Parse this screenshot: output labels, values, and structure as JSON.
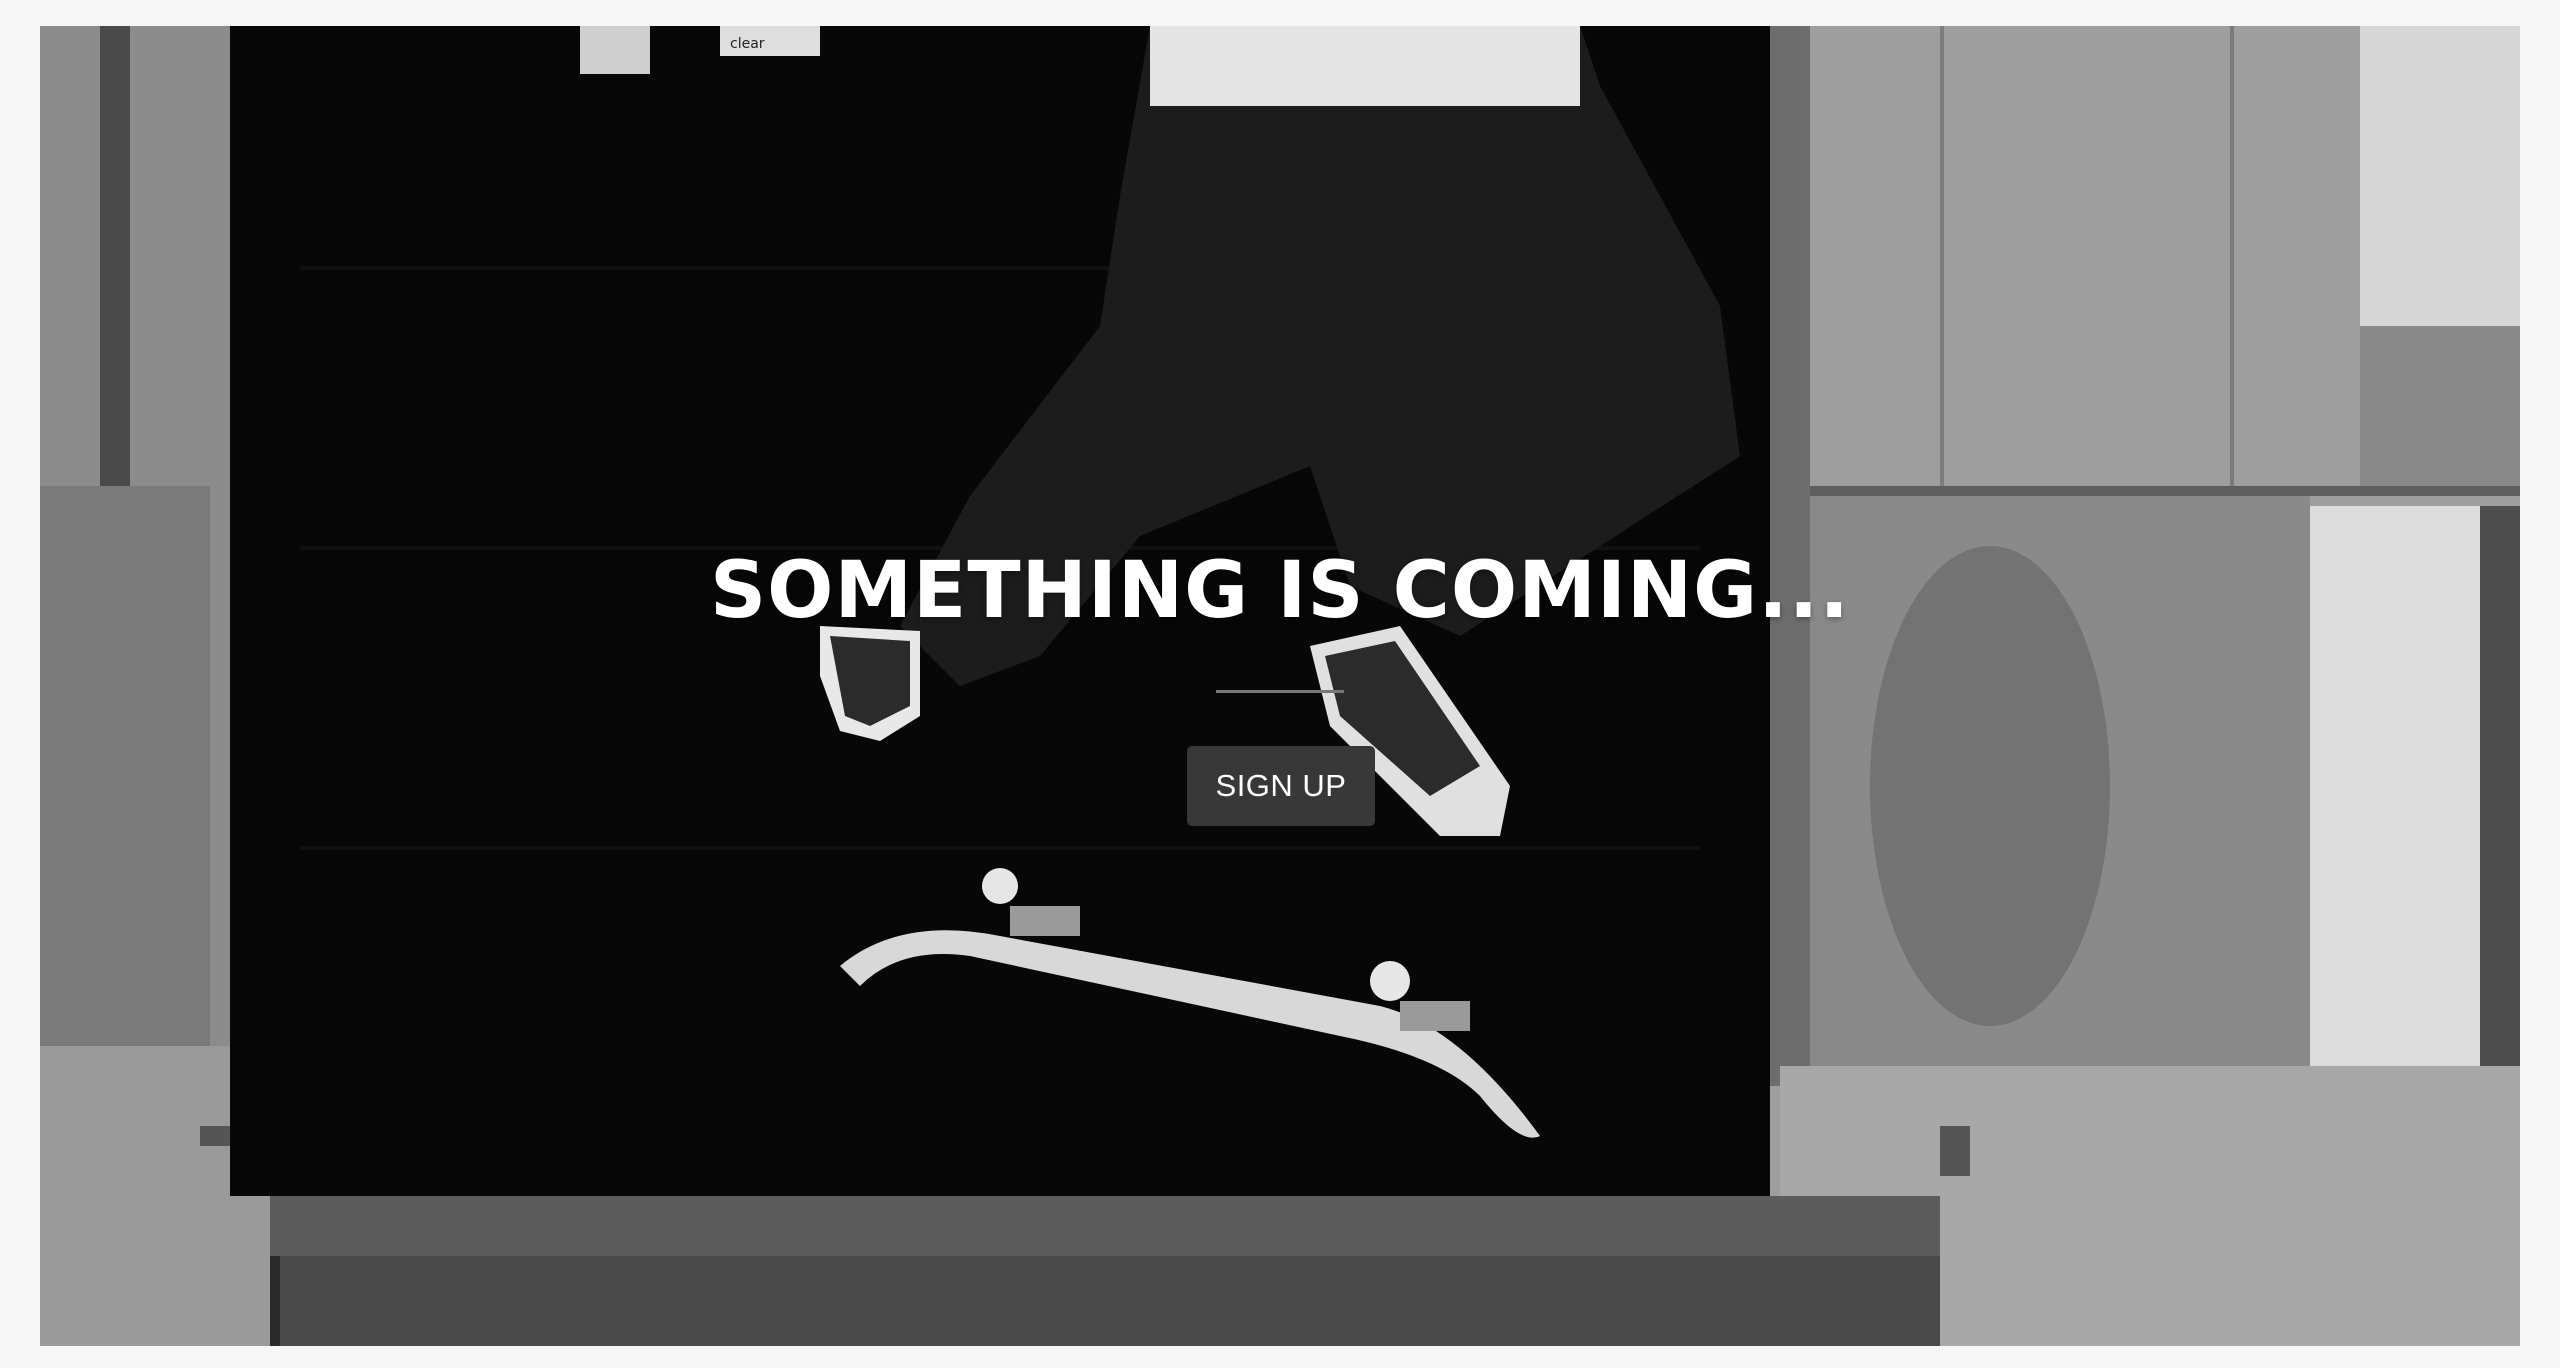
{
  "hero": {
    "headline": "SOMETHING IS COMING...",
    "cta_label": "SIGN UP",
    "sticker_text": "clear"
  },
  "colors": {
    "page_background": "#f6f6f6",
    "button_background": "#383838",
    "button_text": "#ffffff",
    "headline_text": "#ffffff",
    "divider": "#777777"
  },
  "image": {
    "description_icon": "skateboarder-photo-icon"
  }
}
